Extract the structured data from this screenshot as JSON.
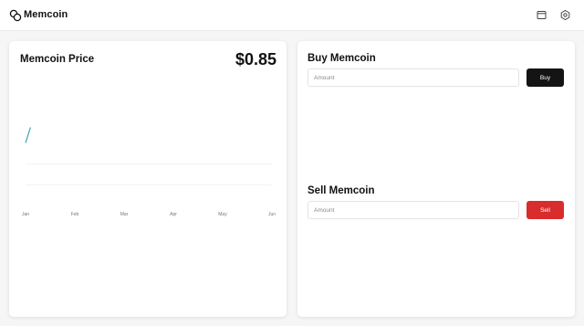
{
  "app": {
    "name": "Memcoin"
  },
  "header": {
    "icons": [
      "logo-icon",
      "wallet-icon",
      "gear-icon"
    ]
  },
  "price_card": {
    "title": "Memcoin Price",
    "price": "$0.85"
  },
  "buy": {
    "title": "Buy Memcoin",
    "amount_placeholder": "Amount",
    "button_label": "Buy"
  },
  "sell": {
    "title": "Sell Memcoin",
    "amount_placeholder": "Amount",
    "button_label": "Sell"
  },
  "colors": {
    "line": "#3aa6b5",
    "buy_button": "#141414",
    "sell_button": "#d92c2c"
  },
  "chart_data": {
    "type": "line",
    "title": "",
    "categories": [
      "Jan",
      "Feb",
      "Mar",
      "Apr",
      "May",
      "Jun"
    ],
    "series": [
      {
        "values": [
          0.82,
          0.85,
          null,
          null,
          null,
          null
        ]
      }
    ],
    "x_positions": [
      0,
      0.1
    ],
    "grid": true,
    "legend": "none"
  }
}
